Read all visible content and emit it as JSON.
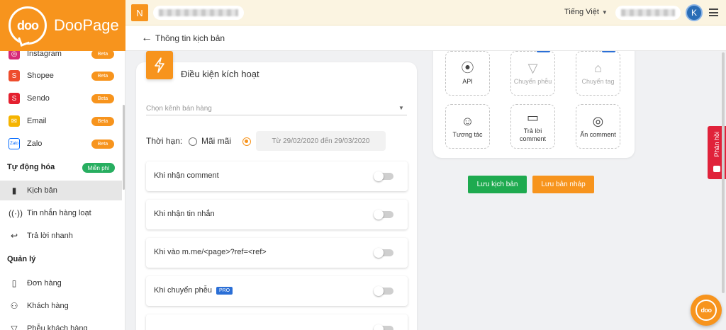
{
  "brand": {
    "name": "DooPage",
    "logo_text": "doo"
  },
  "header": {
    "workspace_initial": "N",
    "language": "Tiếng Việt",
    "user_initial": "K"
  },
  "subheader": {
    "title": "Thông tin kịch bản"
  },
  "sidebar": {
    "channels": [
      {
        "label": "Instagram",
        "badge": "Beta",
        "icon": "instagram-icon",
        "color": "#d62976"
      },
      {
        "label": "Shopee",
        "badge": "Beta",
        "icon": "shopee-icon",
        "color": "#ee4d2d"
      },
      {
        "label": "Sendo",
        "badge": "Beta",
        "icon": "sendo-icon",
        "color": "#e4202f"
      },
      {
        "label": "Email",
        "badge": "Beta",
        "icon": "email-icon",
        "color": "#f5b400"
      },
      {
        "label": "Zalo",
        "badge": "Beta",
        "icon": "zalo-icon",
        "color": "#0068ff"
      }
    ],
    "automation_section": "Tự động hóa",
    "automation_badge": "Miễn phí",
    "automation_items": [
      {
        "label": "Kịch bản",
        "icon": "clipboard-icon",
        "active": true
      },
      {
        "label": "Tin nhắn hàng loạt",
        "icon": "broadcast-icon"
      },
      {
        "label": "Trả lời nhanh",
        "icon": "reply-icon"
      }
    ],
    "manage_section": "Quản lý",
    "manage_items": [
      {
        "label": "Đơn hàng",
        "icon": "order-icon"
      },
      {
        "label": "Khách hàng",
        "icon": "customers-icon"
      },
      {
        "label": "Phễu khách hàng",
        "icon": "funnel-icon"
      }
    ]
  },
  "trigger_card": {
    "title": "Điều kiện kích hoạt",
    "channel_placeholder": "Chọn kênh bán hàng",
    "duration_label": "Thời hạn:",
    "forever_label": "Mãi mãi",
    "date_range": "Từ 29/02/2020 đến 29/03/2020",
    "triggers": [
      {
        "label": "Khi nhận comment",
        "pro": false
      },
      {
        "label": "Khi nhận tin nhắn",
        "pro": false
      },
      {
        "label": "Khi vào m.me/<page>?ref=<ref>",
        "pro": false
      },
      {
        "label": "Khi chuyển phễu",
        "pro": true,
        "pro_label": "PRO"
      }
    ]
  },
  "actions": {
    "tiles": [
      {
        "label": "API",
        "icon": "api-icon",
        "pro": false,
        "dim": false
      },
      {
        "label": "Chuyển phễu",
        "icon": "funnel-icon",
        "pro": true,
        "dim": true
      },
      {
        "label": "Chuyển tag",
        "icon": "tag-icon",
        "pro": true,
        "dim": true
      },
      {
        "label": "Tương tác",
        "icon": "emoji-add-icon",
        "pro": false,
        "dim": false
      },
      {
        "label": "Trả lời comment",
        "icon": "chat-icon",
        "pro": false,
        "dim": false
      },
      {
        "label": "Ẩn comment",
        "icon": "eye-off-icon",
        "pro": false,
        "dim": false
      }
    ],
    "pro_label": "PRO"
  },
  "buttons": {
    "save": "Lưu kịch bản",
    "draft": "Lưu bản nháp"
  },
  "feedback": {
    "label": "Phản hồi"
  },
  "colors": {
    "brand": "#f7941d",
    "success": "#1eaa4f",
    "pro": "#2b6fd6",
    "feedback": "#e0223a"
  }
}
